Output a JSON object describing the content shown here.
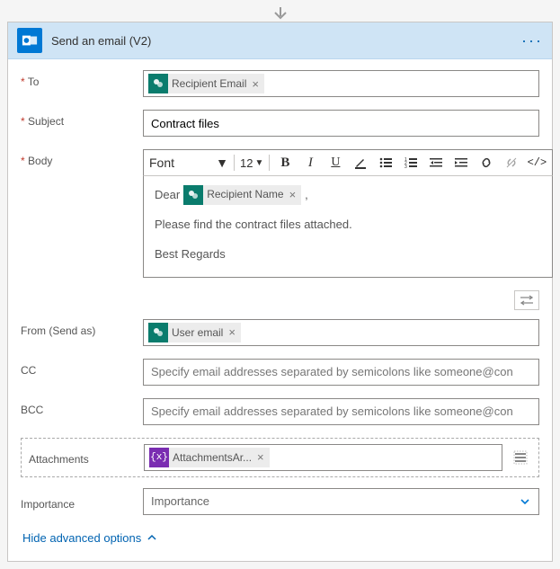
{
  "header": {
    "title": "Send an email (V2)"
  },
  "fields": {
    "to_label": "To",
    "to_chip": "Recipient Email",
    "subject_label": "Subject",
    "subject_value": "Contract files",
    "body_label": "Body",
    "body_font": "Font",
    "body_font_size": "12",
    "body_greeting_prefix": "Dear",
    "body_recipient_chip": "Recipient Name",
    "body_greeting_suffix": ",",
    "body_line2": "Please find the contract files attached.",
    "body_line3": "Best Regards",
    "from_label": "From (Send as)",
    "from_chip": "User email",
    "cc_label": "CC",
    "cc_placeholder": "Specify email addresses separated by semicolons like someone@con",
    "bcc_label": "BCC",
    "bcc_placeholder": "Specify email addresses separated by semicolons like someone@con",
    "attachments_label": "Attachments",
    "attachments_chip": "AttachmentsAr...",
    "importance_label": "Importance",
    "importance_placeholder": "Importance"
  },
  "footer": {
    "advanced_toggle": "Hide advanced options"
  }
}
